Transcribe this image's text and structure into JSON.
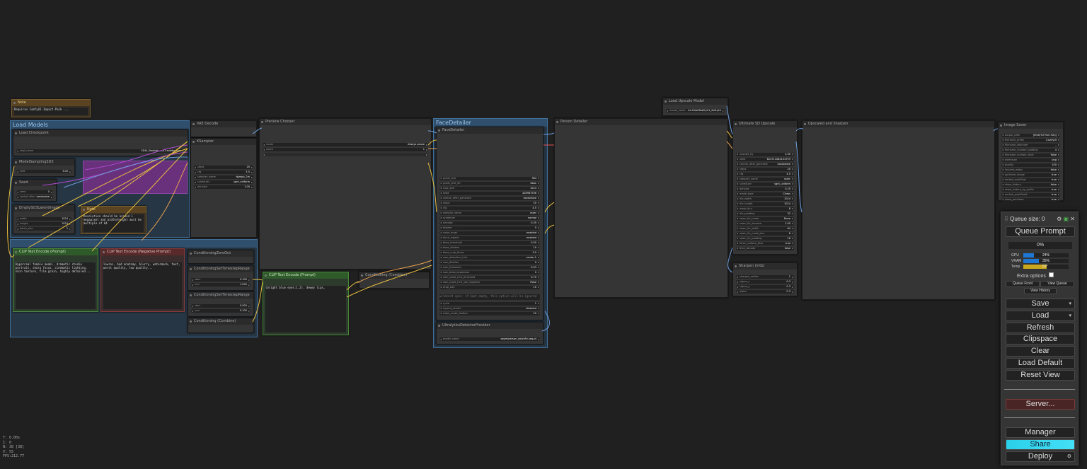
{
  "groups": {
    "load_models": "Load Models",
    "face_detailer": "FaceDetailer"
  },
  "nodes": {
    "note_top": {
      "title": "Note",
      "text": "Requires ComfyUI-Impact-Pack ..."
    },
    "load_checkpoint": {
      "title": "Load Checkpoint",
      "ckpt_label": "ckpt_name",
      "ckpt_value": "SDXL_Realistic..._v1.safetensors"
    },
    "model_sampling": {
      "title": "ModelSamplingSD3",
      "label": "shift",
      "value": "3.00"
    },
    "seed": {
      "title": "Seed",
      "seed_label": "seed",
      "seed_value": "0",
      "ctrl_label": "control after",
      "ctrl_value": "randomize"
    },
    "empty_latent": {
      "title": "EmptySD3LatentImage",
      "w_label": "width",
      "w_value": "1024",
      "h_label": "height",
      "h_value": "1024",
      "b_label": "batch_size",
      "b_value": "2"
    },
    "note_mid": {
      "title": "Note",
      "text": "Resolution should be around 1 megapixel and width/height must be multiple of 64"
    },
    "vae_decode": {
      "title": "VAE Decode"
    },
    "ksampler": {
      "title": "KSampler",
      "rows": [
        [
          "steps",
          "20"
        ],
        [
          "cfg",
          "4.5"
        ],
        [
          "sampler_name",
          "dpmpp_2m"
        ],
        [
          "scheduler",
          "sgm_uniform"
        ],
        [
          "denoise",
          "1.00"
        ]
      ]
    },
    "preview_chooser": {
      "title": "Preview Chooser",
      "mode_label": "mode",
      "mode_value": "Always pause",
      "count_label": "count",
      "count_value": "1"
    },
    "clip_pos": {
      "title": "CLIP Text Encode (Prompt)",
      "text": "Hyperreal female model, dramatic studio portrait, sharp focus, cinematic lighting, skin texture, film grain, highly detailed..."
    },
    "clip_neg": {
      "title": "CLIP Text Encode (Negative Prompt)",
      "text": "lowres, bad anatomy, blurry, watermark, text, worst quality, low quality..."
    },
    "cond_zero": {
      "title": "ConditioningZeroOut"
    },
    "cond_range1": {
      "title": "ConditioningSetTimestepRange",
      "r1": [
        "start",
        "0.100"
      ],
      "r2": [
        "end",
        "1.000"
      ]
    },
    "cond_range2": {
      "title": "ConditioningSetTimestepRange",
      "r1": [
        "start",
        "0.000"
      ],
      "r2": [
        "end",
        "0.100"
      ]
    },
    "cond_combine1": {
      "title": "Conditioning (Combine)"
    },
    "clip_face": {
      "title": "CLIP Text Encode (Prompt)",
      "text": "(bright blue eyes:1.2), dewey lips,"
    },
    "cond_combine2": {
      "title": "Conditioning (Combine)"
    },
    "face_detailer": {
      "title": "FaceDetailer",
      "rows": [
        [
          "guide_size",
          "384"
        ],
        [
          "guide_size_for",
          "bbox"
        ],
        [
          "max_size",
          "1024"
        ],
        [
          "seed",
          "428987536"
        ],
        [
          "control_after_generate",
          "randomize"
        ],
        [
          "steps",
          "20"
        ],
        [
          "cfg",
          "4.5"
        ],
        [
          "sampler_name",
          "euler"
        ],
        [
          "scheduler",
          "normal"
        ],
        [
          "denoise",
          "0.35"
        ],
        [
          "feather",
          "5"
        ],
        [
          "noise_mask",
          "enabled"
        ],
        [
          "force_inpaint",
          "enabled"
        ],
        [
          "bbox_threshold",
          "0.50"
        ],
        [
          "bbox_dilation",
          "10"
        ],
        [
          "bbox_crop_factor",
          "3.0"
        ],
        [
          "sam_detection_hint",
          "center-1"
        ],
        [
          "sam_dilation",
          "0"
        ],
        [
          "sam_threshold",
          "0.93"
        ],
        [
          "sam_bbox_expansion",
          "0"
        ],
        [
          "sam_mask_hint_threshold",
          "0.70"
        ],
        [
          "sam_mask_hint_use_negative",
          "False"
        ],
        [
          "drop_size",
          "10"
        ]
      ],
      "wildcard": "wildcard spec: if kept empty, this option will be ignored",
      "rows2": [
        [
          "cycle",
          "1"
        ],
        [
          "inpaint_model",
          "disabled"
        ],
        [
          "noise_mask_feather",
          "20"
        ]
      ]
    },
    "ultra_provider": {
      "title": "UltralyticsDetectorProvider",
      "label": "model_name",
      "value": "segm/person_yolov8n-seg.pt"
    },
    "person_detailer": {
      "title": "Person Detailer"
    },
    "load_upscale": {
      "title": "Load Upscale Model",
      "label": "model_name",
      "value": "4x-ClearRealityV1_Soft.pth"
    },
    "upscale_sd": {
      "title": "Ultimate SD Upscale",
      "rows": [
        [
          "upscale_by",
          "2.00"
        ],
        [
          "seed",
          "624711084104793"
        ],
        [
          "control_after_generate",
          "randomize"
        ],
        [
          "steps",
          "20"
        ],
        [
          "cfg",
          "4.5"
        ],
        [
          "sampler_name",
          "euler"
        ],
        [
          "scheduler",
          "sgm_uniform"
        ],
        [
          "denoise",
          "0.20"
        ],
        [
          "mode_type",
          "Chess"
        ],
        [
          "tile_width",
          "1024"
        ],
        [
          "tile_height",
          "1024"
        ],
        [
          "mask_blur",
          "8"
        ],
        [
          "tile_padding",
          "32"
        ],
        [
          "seam_fix_mode",
          "None"
        ],
        [
          "seam_fix_denoise",
          "1.00"
        ],
        [
          "seam_fix_width",
          "64"
        ],
        [
          "seam_fix_mask_blur",
          "8"
        ],
        [
          "seam_fix_padding",
          "16"
        ],
        [
          "force_uniform_tiles",
          "true"
        ],
        [
          "tiled_decode",
          "false"
        ]
      ]
    },
    "sharpen": {
      "title": "Sharpen (mtb)",
      "rows": [
        [
          "sharpen_radius",
          "1"
        ],
        [
          "sigma_x",
          "0.3"
        ],
        [
          "sigma_y",
          "0.3"
        ],
        [
          "alpha",
          "0.3"
        ]
      ]
    },
    "upscaled_sharpen": {
      "title": "Upscaled and Sharpen"
    },
    "image_saver": {
      "title": "Image Saver",
      "rows": [
        [
          "output_path",
          "[time(%Y-%m-%d)]"
        ],
        [
          "filename_prefix",
          "ComfyUI"
        ],
        [
          "filename_delimiter",
          "_"
        ],
        [
          "filename_number_padding",
          "4"
        ],
        [
          "filename_number_start",
          "false"
        ],
        [
          "extension",
          "png"
        ],
        [
          "quality",
          "100"
        ],
        [
          "lossless_webp",
          "false"
        ],
        [
          "optimize_image",
          "true"
        ],
        [
          "embed_workflow",
          "true"
        ],
        [
          "show_history",
          "false"
        ],
        [
          "show_history_by_prefix",
          "true"
        ],
        [
          "embed_workflow2",
          "true"
        ],
        [
          "show_previews",
          "true"
        ]
      ]
    }
  },
  "stats": [
    "T: 0.00s",
    "I: 0",
    "N: 38 [38]",
    "V: 55",
    "FPS:212.77"
  ],
  "menu": {
    "queue_size": "Queue size: 0",
    "queue_prompt": "Queue Prompt",
    "progress": "0%",
    "gpu_label": "GPU",
    "gpu_value": "24%",
    "gpu_pct": 24,
    "vram_label": "VRAM",
    "vram_value": "35%",
    "vram_pct": 35,
    "temp_label": "Temp",
    "temp_value": "52°",
    "temp_pct": 52,
    "extra_options": "Extra options",
    "queue_front": "Queue Front",
    "view_queue": "View Queue",
    "view_history": "View History",
    "save": "Save",
    "load": "Load",
    "refresh": "Refresh",
    "clipspace": "Clipspace",
    "clear": "Clear",
    "load_default": "Load Default",
    "reset_view": "Reset View",
    "server": "Server...",
    "manager": "Manager",
    "share": "Share",
    "deploy": "Deploy"
  },
  "colors": {
    "accent_blue": "#1f77d4",
    "temp_yellow": "#c9a81e",
    "share_gradient": "#2ad0e8"
  }
}
